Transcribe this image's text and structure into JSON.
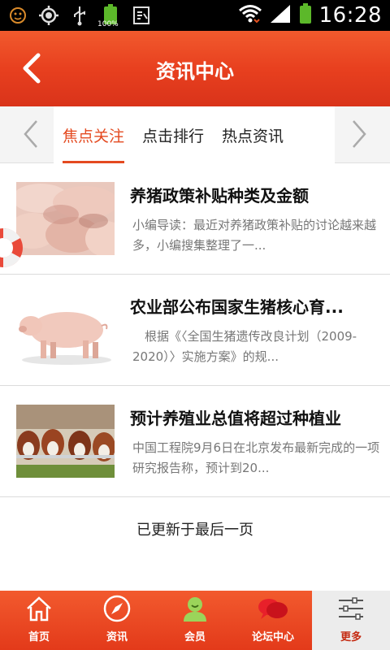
{
  "status_bar": {
    "time": "16:28",
    "battery_percent_label": "100%"
  },
  "header": {
    "title": "资讯中心"
  },
  "tabs": [
    {
      "label": "焦点关注",
      "active": true
    },
    {
      "label": "点击排行",
      "active": false
    },
    {
      "label": "热点资讯",
      "active": false
    }
  ],
  "news": [
    {
      "title": "养猪政策补贴种类及金额",
      "desc": "小编导读：最近对养猪政策补贴的讨论越来越多，小编搜集整理了一..."
    },
    {
      "title": "农业部公布国家生猪核心育...",
      "desc": "　根据《〈全国生猪遗传改良计划（2009-2020）〉实施方案》的规..."
    },
    {
      "title": "预计养殖业总值将超过种植业",
      "desc": "中国工程院9月6日在北京发布最新完成的一项研究报告称，预计到20..."
    }
  ],
  "end_note": "已更新于最后一页",
  "bottom_nav": [
    {
      "label": "首页",
      "icon": "home-icon"
    },
    {
      "label": "资讯",
      "icon": "compass-icon"
    },
    {
      "label": "会员",
      "icon": "member-icon"
    },
    {
      "label": "论坛中心",
      "icon": "forum-icon"
    },
    {
      "label": "更多",
      "icon": "settings-sliders-icon",
      "active": true
    }
  ],
  "colors": {
    "brand": "#e8401f",
    "active_tab": "#e44a20"
  }
}
